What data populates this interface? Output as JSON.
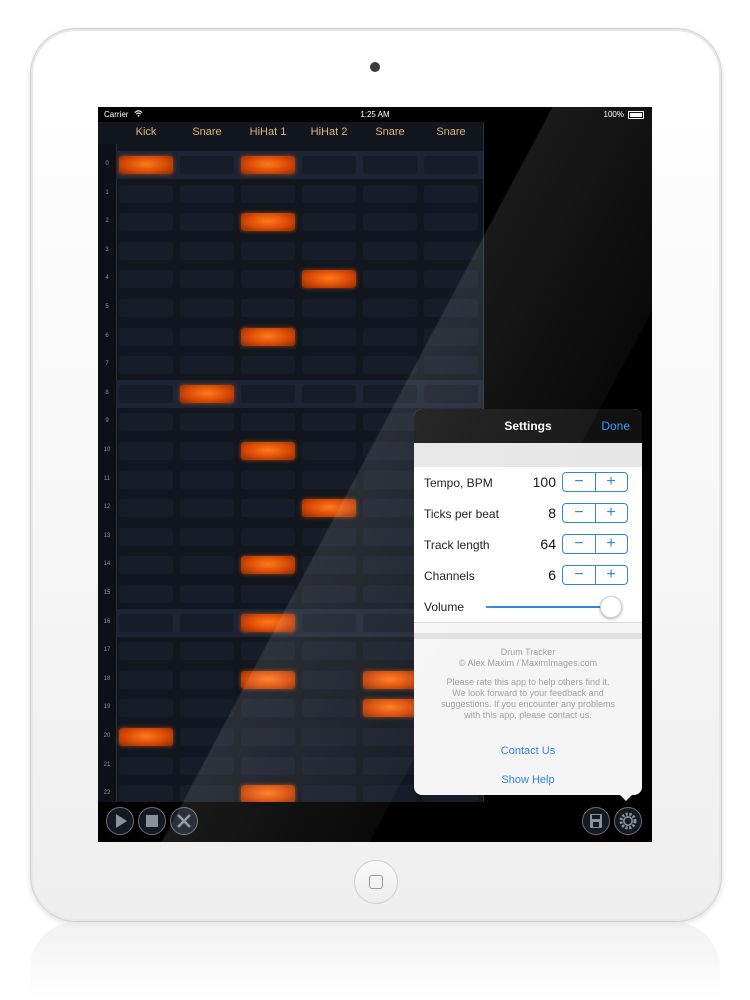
{
  "status_bar": {
    "carrier": "Carrier",
    "time": "1:25 AM",
    "battery": "100%"
  },
  "channels": [
    "Kick",
    "Snare",
    "HiHat 1",
    "HiHat 2",
    "Snare",
    "Snare"
  ],
  "row_numbers": [
    "0",
    "1",
    "2",
    "3",
    "4",
    "5",
    "6",
    "7",
    "8",
    "9",
    "10",
    "11",
    "12",
    "13",
    "14",
    "15",
    "16",
    "17",
    "18",
    "19",
    "20",
    "21",
    "22"
  ],
  "highlighted_rows": [
    0,
    8,
    16
  ],
  "active_cells": [
    [
      0,
      0
    ],
    [
      0,
      2
    ],
    [
      2,
      2
    ],
    [
      4,
      3
    ],
    [
      6,
      2
    ],
    [
      8,
      1
    ],
    [
      10,
      2
    ],
    [
      12,
      3
    ],
    [
      14,
      2
    ],
    [
      16,
      2
    ],
    [
      18,
      2
    ],
    [
      18,
      4
    ],
    [
      19,
      4
    ],
    [
      20,
      0
    ],
    [
      22,
      2
    ]
  ],
  "colors": {
    "accent": "#2f86e8",
    "active_cell": "#d84a06",
    "channel_label": "#e1b27d"
  },
  "toolbar": {
    "left_buttons": [
      "play-icon",
      "stop-icon",
      "clear-icon"
    ],
    "right_buttons": [
      "save-icon",
      "gear-icon"
    ]
  },
  "settings": {
    "title": "Settings",
    "done": "Done",
    "rows": [
      {
        "label": "Tempo, BPM",
        "value": "100"
      },
      {
        "label": "Ticks per beat",
        "value": "8"
      },
      {
        "label": "Track length",
        "value": "64"
      },
      {
        "label": "Channels",
        "value": "6"
      }
    ],
    "stepper_minus": "−",
    "stepper_plus": "+",
    "volume_label": "Volume",
    "volume_level": 0.95,
    "app_name": "Drum Tracker",
    "copyright": "© Alex Maxim / MaximImages.com",
    "message_lines": [
      "Please rate this app to help others find it.",
      "We look forward to your feedback and",
      "suggestions. If you encounter any problems",
      "with this app, please contact us."
    ],
    "contact_link": "Contact Us",
    "help_link": "Show Help"
  }
}
